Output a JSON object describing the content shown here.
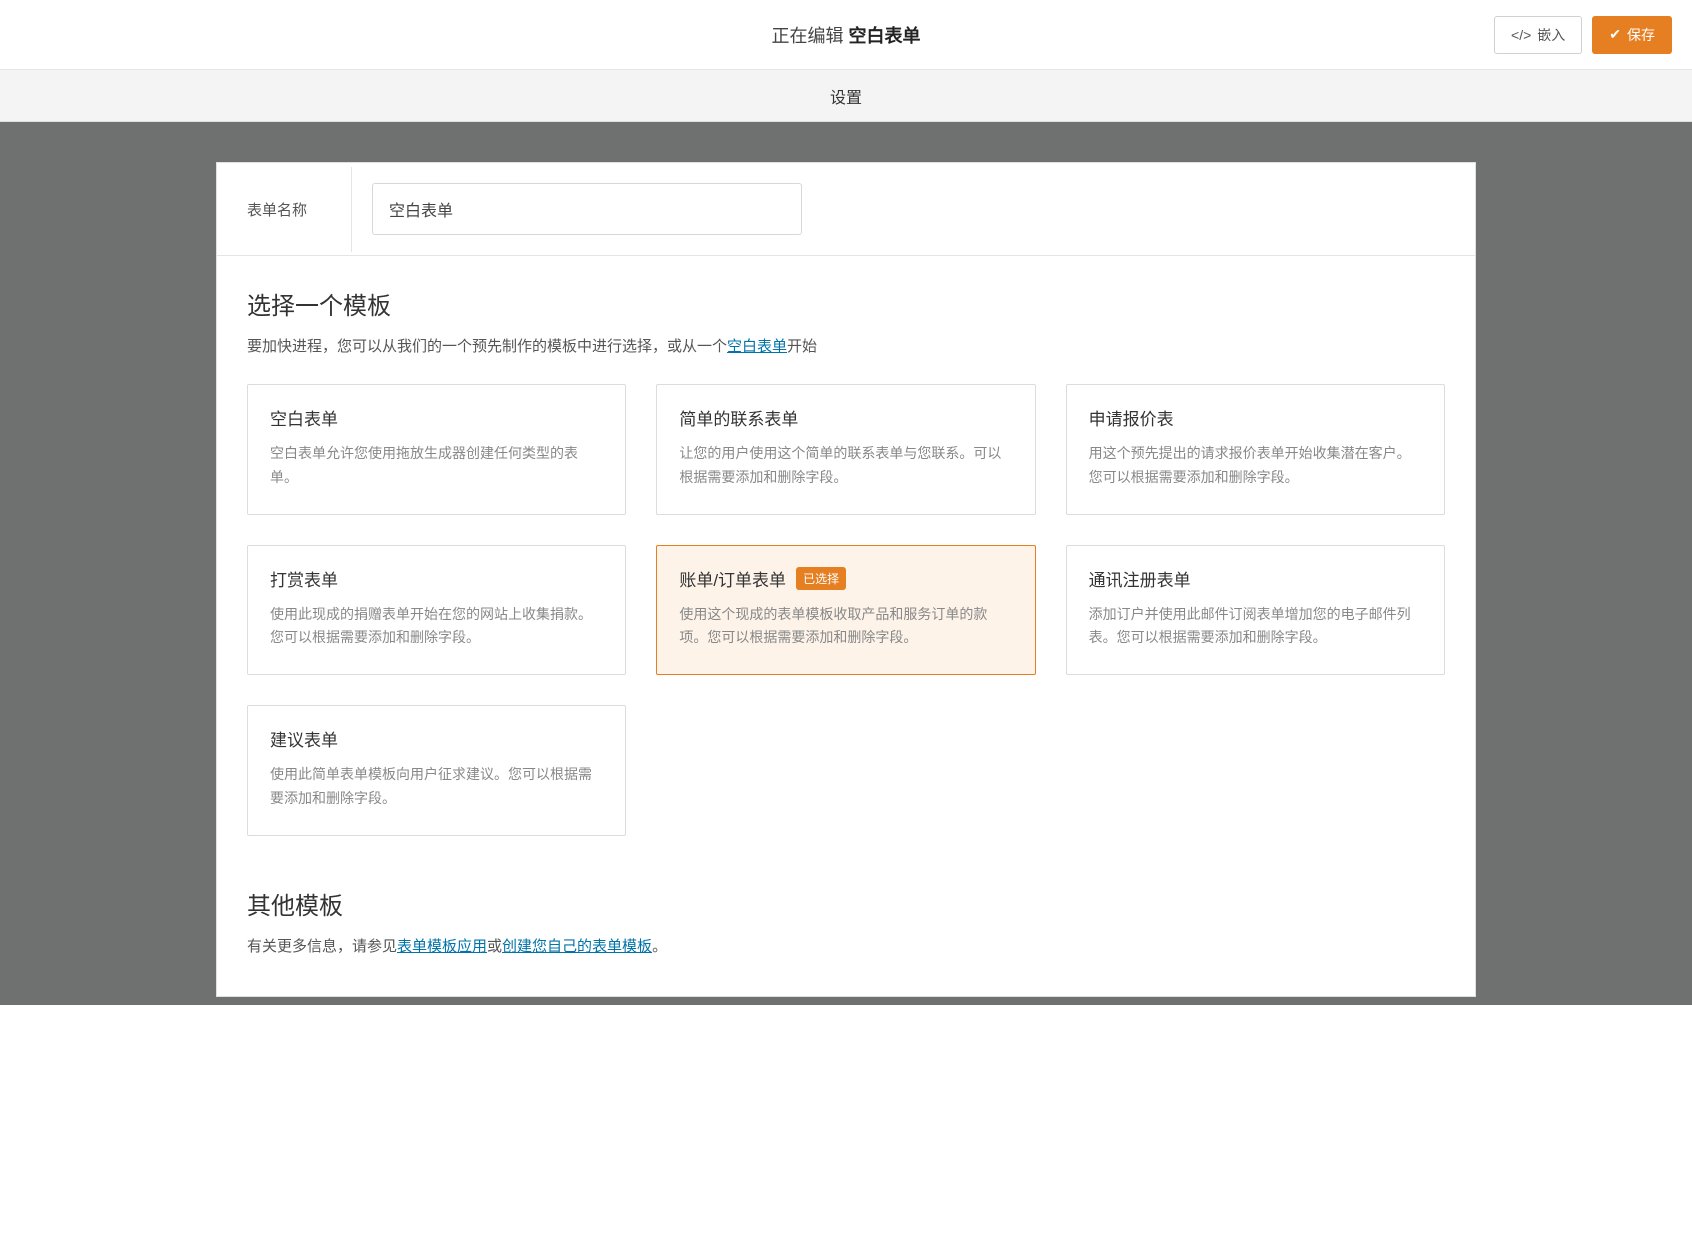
{
  "header": {
    "editing_prefix": "正在编辑 ",
    "form_title": "空白表单",
    "embed_label": "嵌入",
    "save_label": "保存"
  },
  "subbar": {
    "settings_label": "设置"
  },
  "form_name": {
    "label": "表单名称",
    "value": "空白表单"
  },
  "templates": {
    "heading": "选择一个模板",
    "desc_pre": "要加快进程，您可以从我们的一个预先制作的模板中进行选择，或从一个",
    "desc_link": "空白表单",
    "desc_post": "开始",
    "selected_badge": "已选择",
    "items": [
      {
        "title": "空白表单",
        "desc": "空白表单允许您使用拖放生成器创建任何类型的表单。",
        "selected": false
      },
      {
        "title": "简单的联系表单",
        "desc": "让您的用户使用这个简单的联系表单与您联系。可以根据需要添加和删除字段。",
        "selected": false
      },
      {
        "title": "申请报价表",
        "desc": "用这个预先提出的请求报价表单开始收集潜在客户。您可以根据需要添加和删除字段。",
        "selected": false
      },
      {
        "title": "打赏表单",
        "desc": "使用此现成的捐赠表单开始在您的网站上收集捐款。您可以根据需要添加和删除字段。",
        "selected": false
      },
      {
        "title": "账单/订单表单",
        "desc": "使用这个现成的表单模板收取产品和服务订单的款项。您可以根据需要添加和删除字段。",
        "selected": true
      },
      {
        "title": "通讯注册表单",
        "desc": "添加订户并使用此邮件订阅表单增加您的电子邮件列表。您可以根据需要添加和删除字段。",
        "selected": false
      },
      {
        "title": "建议表单",
        "desc": "使用此简单表单模板向用户征求建议。您可以根据需要添加和删除字段。",
        "selected": false
      }
    ]
  },
  "other": {
    "heading": "其他模板",
    "desc_pre": "有关更多信息，请参见",
    "link1": "表单模板应用",
    "mid": "或",
    "link2": "创建您自己的表单模板",
    "desc_post": "。"
  }
}
